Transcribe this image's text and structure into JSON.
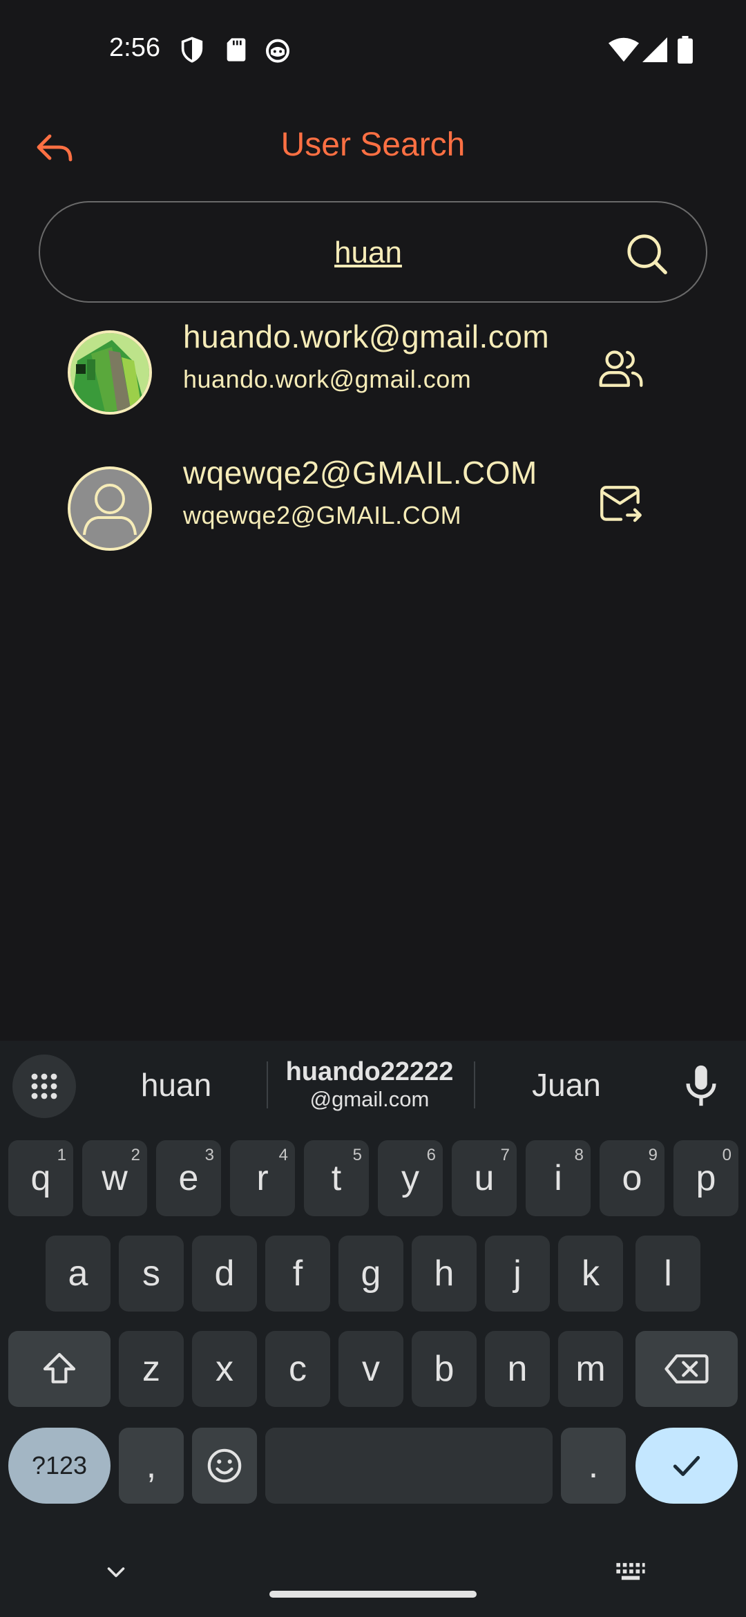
{
  "status_bar": {
    "time": "2:56",
    "left_icons": [
      "shield-icon",
      "sd-card-icon",
      "cat-face-icon"
    ],
    "right_icons": [
      "wifi-icon",
      "cell-signal-icon",
      "battery-icon"
    ]
  },
  "header": {
    "title": "User Search",
    "back_icon": "reply-arrow-icon",
    "accent_color": "#ff7043"
  },
  "search": {
    "value": "huan",
    "icon": "search-icon"
  },
  "results": [
    {
      "name": "huando.work@gmail.com",
      "email": "huando.work@gmail.com",
      "avatar": "photo",
      "action_icon": "users-icon"
    },
    {
      "name": "wqewqe2@GMAIL.COM",
      "email": "wqewqe2@GMAIL.COM",
      "avatar": "default-person",
      "action_icon": "mail-forward-icon"
    }
  ],
  "keyboard": {
    "suggestions": {
      "left": "huan",
      "center_main": "huando22222",
      "center_sub": "@gmail.com",
      "right": "Juan"
    },
    "row1": [
      "q",
      "w",
      "e",
      "r",
      "t",
      "y",
      "u",
      "i",
      "o",
      "p"
    ],
    "row1_hints": [
      "1",
      "2",
      "3",
      "4",
      "5",
      "6",
      "7",
      "8",
      "9",
      "0"
    ],
    "row2": [
      "a",
      "s",
      "d",
      "f",
      "g",
      "h",
      "j",
      "k",
      "l"
    ],
    "row3": [
      "z",
      "x",
      "c",
      "v",
      "b",
      "n",
      "m"
    ],
    "num_key": "?123",
    "comma_key": ",",
    "period_key": "."
  },
  "colors": {
    "text": "#f6ecb8",
    "background": "#171719",
    "keyboard_bg": "#1c1f22",
    "key_bg": "#2f3336",
    "enter_bg": "#c4e7ff"
  }
}
